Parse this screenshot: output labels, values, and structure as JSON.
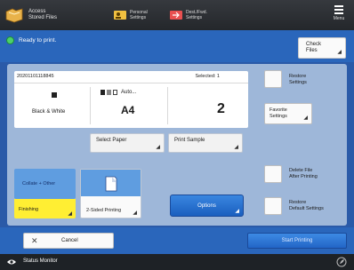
{
  "topbar": {
    "app_line1": "Access",
    "app_line2": "Stored Files",
    "btn1_line1": "Personal",
    "btn1_line2": "Settings",
    "btn2_line1": "Dest./Fwd.",
    "btn2_line2": "Settings",
    "menu_label": "Menu"
  },
  "status": {
    "text": "Ready to print.",
    "check_files_line1": "Check",
    "check_files_line2": "Files"
  },
  "info": {
    "file_code": "20201101118845",
    "selected": "Selected: 1",
    "color_mode": "Black & White",
    "paper_auto": "Auto...",
    "paper_size": "A4",
    "copies": "2"
  },
  "buttons": {
    "select_paper": "Select Paper",
    "print_sample": "Print Sample",
    "collate": "Collate + Other",
    "finishing": "Finishing",
    "two_sided": "2-Sided Printing",
    "options": "Options"
  },
  "side": {
    "restore_settings_1": "Restore",
    "restore_settings_2": "Settings",
    "favorite_1": "Favorite",
    "favorite_2": "Settings",
    "delete_1": "Delete File",
    "delete_2": "After Printing",
    "restore_default_1": "Restore",
    "restore_default_2": "Default Settings"
  },
  "bottom": {
    "cancel": "Cancel",
    "start": "Start Printing"
  },
  "monitor": {
    "label": "Status Monitor"
  },
  "colors": {
    "accent": "#2a66bb",
    "ready": "#4cd06a",
    "finishing": "#ffee33"
  }
}
